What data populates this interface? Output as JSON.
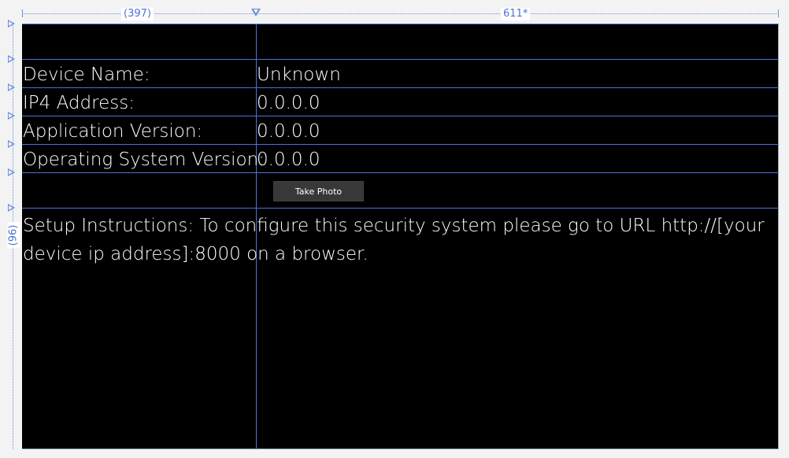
{
  "rulers": {
    "column_1_width": "(397)",
    "column_2_width": "611*",
    "row_height": "(96)"
  },
  "info_rows": [
    {
      "label": "Device Name:",
      "value": "Unknown"
    },
    {
      "label": "IP4 Address:",
      "value": "0.0.0.0"
    },
    {
      "label": "Application Version:",
      "value": "0.0.0.0"
    },
    {
      "label": "Operating System Version:",
      "value": "0.0.0.0"
    }
  ],
  "take_photo_label": "Take Photo",
  "setup_instructions": "Setup Instructions: To configure this security system please go to URL http://[your device ip address]:8000 on a browser.",
  "colors": {
    "background": "#000000",
    "text": "#ffffff",
    "guide": "#4a73d6",
    "button": "#383838"
  }
}
